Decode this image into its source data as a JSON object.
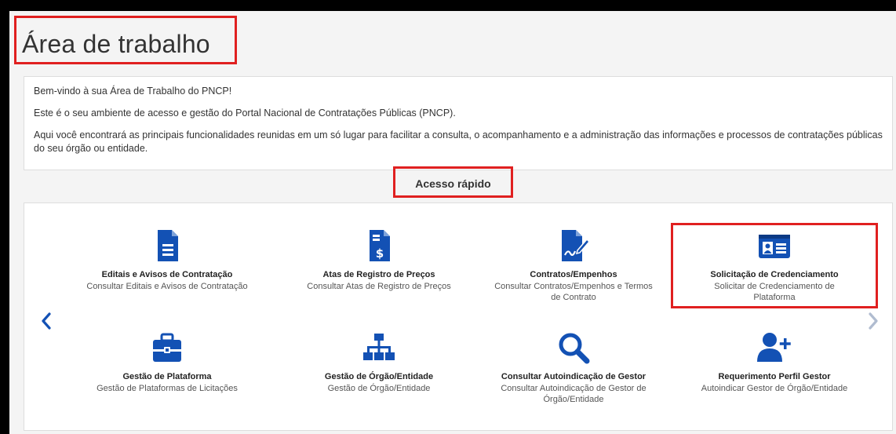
{
  "page": {
    "title": "Área de trabalho"
  },
  "welcome": {
    "line1": "Bem-vindo à sua Área de Trabalho do PNCP!",
    "line2": "Este é o seu ambiente de acesso e gestão do Portal Nacional de Contratações Públicas (PNCP).",
    "line3": "Aqui você encontrará as principais funcionalidades reunidas em um só lugar para facilitar a consulta, o acompanhamento e a administração das informações e processos de contratações públicas do seu órgão ou entidade."
  },
  "quick_access": {
    "title": "Acesso rápido",
    "cards": [
      {
        "title": "Editais e Avisos de Contratação",
        "desc": "Consultar Editais e Avisos de Contratação",
        "icon": "document-icon"
      },
      {
        "title": "Atas de Registro de Preços",
        "desc": "Consultar Atas de Registro de Preços",
        "icon": "price-document-icon"
      },
      {
        "title": "Contratos/Empenhos",
        "desc": "Consultar Contratos/Empenhos e Termos de Contrato",
        "icon": "contract-sign-icon"
      },
      {
        "title": "Solicitação de Credenciamento",
        "desc": "Solicitar de Credenciamento de Plataforma",
        "icon": "id-card-icon"
      },
      {
        "title": "Gestão de Plataforma",
        "desc": "Gestão de Plataformas de Licitações",
        "icon": "briefcase-icon"
      },
      {
        "title": "Gestão de Órgão/Entidade",
        "desc": "Gestão de Órgão/Entidade",
        "icon": "org-chart-icon"
      },
      {
        "title": "Consultar Autoindicação de Gestor",
        "desc": "Consultar Autoindicação de Gestor de Órgão/Entidade",
        "icon": "search-icon"
      },
      {
        "title": "Requerimento Perfil Gestor",
        "desc": "Autoindicar Gestor de Órgão/Entidade",
        "icon": "user-add-icon"
      }
    ]
  },
  "colors": {
    "accent": "#1351b4",
    "highlight": "#e02020",
    "arrow_disabled": "#b0bcd0"
  }
}
